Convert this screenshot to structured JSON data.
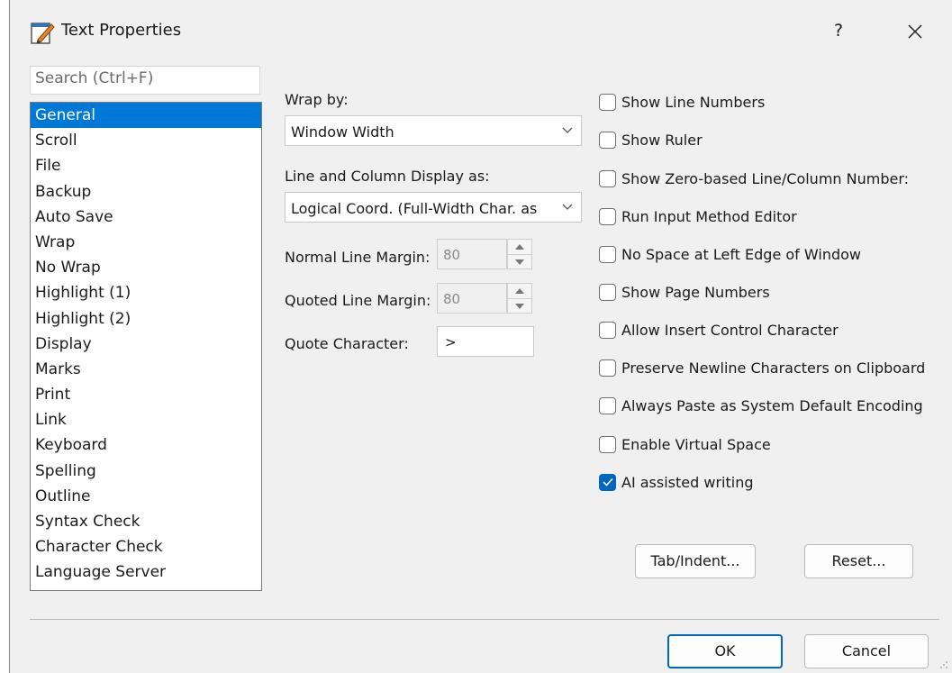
{
  "dialog": {
    "title": "Text Properties",
    "help_label": "?"
  },
  "search": {
    "placeholder": "Search (Ctrl+F)"
  },
  "categories": [
    "General",
    "Scroll",
    "File",
    "Backup",
    "Auto Save",
    "Wrap",
    "No Wrap",
    "Highlight (1)",
    "Highlight (2)",
    "Display",
    "Marks",
    "Print",
    "Link",
    "Keyboard",
    "Spelling",
    "Outline",
    "Syntax Check",
    "Character Check",
    "Language Server"
  ],
  "selected_category": "General",
  "wrap_by": {
    "label": "Wrap by:",
    "value": "Window Width"
  },
  "line_column": {
    "label": "Line and Column Display as:",
    "value": "Logical Coord. (Full-Width Char. as"
  },
  "normal_margin": {
    "label": "Normal Line Margin:",
    "value": "80"
  },
  "quoted_margin": {
    "label": "Quoted Line Margin:",
    "value": "80"
  },
  "quote_char": {
    "label": "Quote Character:",
    "value": ">"
  },
  "options": [
    {
      "label": "Show Line Numbers",
      "checked": false
    },
    {
      "label": "Show Ruler",
      "checked": false
    },
    {
      "label": "Show Zero-based Line/Column Number:",
      "checked": false
    },
    {
      "label": "Run Input Method Editor",
      "checked": false
    },
    {
      "label": "No Space at Left Edge of Window",
      "checked": false
    },
    {
      "label": "Show Page Numbers",
      "checked": false
    },
    {
      "label": "Allow Insert Control Character",
      "checked": false
    },
    {
      "label": "Preserve Newline Characters on Clipboard",
      "checked": false
    },
    {
      "label": "Always Paste as System Default Encoding",
      "checked": false
    },
    {
      "label": "Enable Virtual Space",
      "checked": false
    },
    {
      "label": "AI assisted writing",
      "checked": true
    }
  ],
  "buttons": {
    "tab_indent": "Tab/Indent...",
    "reset": "Reset...",
    "ok": "OK",
    "cancel": "Cancel"
  },
  "colors": {
    "selection": "#0078d7",
    "checkbox_checked": "#0067c0",
    "dialog_bg": "#f0f0f0"
  }
}
